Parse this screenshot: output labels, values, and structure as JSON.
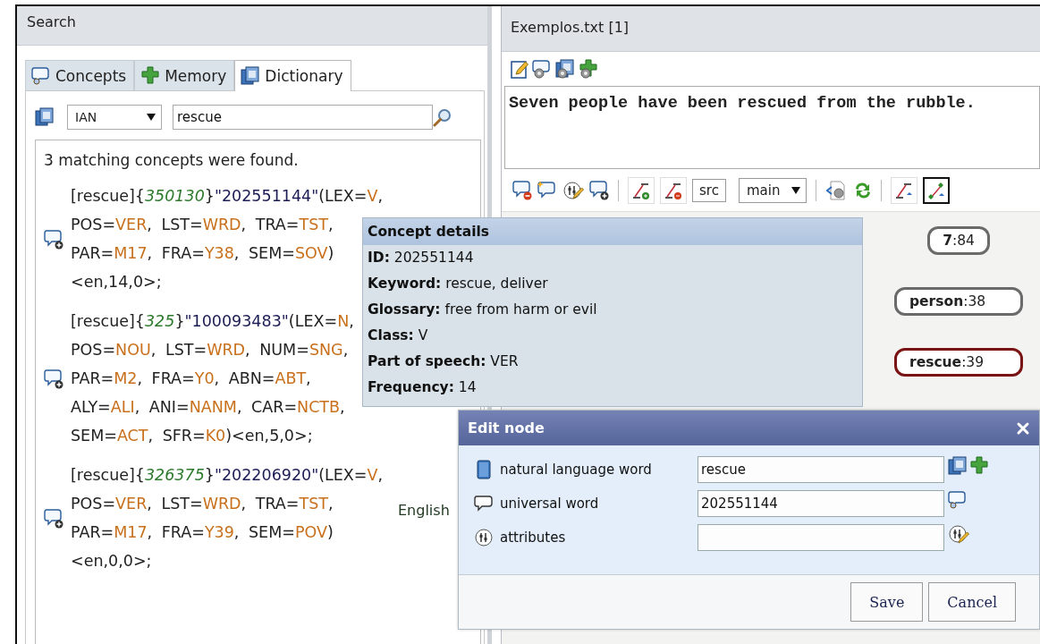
{
  "search_panel": {
    "title": "Search",
    "tabs": [
      {
        "label": "Concepts",
        "selected": false
      },
      {
        "label": "Memory",
        "selected": false
      },
      {
        "label": "Dictionary",
        "selected": true
      }
    ],
    "dictionary_select": {
      "value": "IAN"
    },
    "search_field": {
      "value": "rescue"
    },
    "result_summary": "3 matching concepts were found.",
    "results": [
      {
        "lines": [
          [
            {
              "text": "[rescue]{",
              "kind": "plain"
            },
            {
              "text": "350130",
              "kind": "number"
            },
            {
              "text": "}",
              "kind": "plain"
            },
            {
              "text": "\"202551144\"",
              "kind": "uw"
            },
            {
              "text": "(LEX=",
              "kind": "plain"
            },
            {
              "text": "V",
              "kind": "value"
            },
            {
              "text": ",",
              "kind": "plain"
            }
          ],
          [
            {
              "text": "POS=",
              "kind": "plain"
            },
            {
              "text": "VER",
              "kind": "value"
            },
            {
              "text": ", LST=",
              "kind": "plain"
            },
            {
              "text": "WRD",
              "kind": "value"
            },
            {
              "text": ", TRA=",
              "kind": "plain"
            },
            {
              "text": "TST",
              "kind": "value"
            },
            {
              "text": ",",
              "kind": "plain"
            }
          ],
          [
            {
              "text": "PAR=",
              "kind": "plain"
            },
            {
              "text": "M17",
              "kind": "value"
            },
            {
              "text": ", FRA=",
              "kind": "plain"
            },
            {
              "text": "Y38",
              "kind": "value"
            },
            {
              "text": ", SEM=",
              "kind": "plain"
            },
            {
              "text": "SOV",
              "kind": "value"
            },
            {
              "text": ")",
              "kind": "plain"
            }
          ],
          [
            {
              "text": "<en,14,0>;",
              "kind": "plain"
            }
          ]
        ]
      },
      {
        "lines": [
          [
            {
              "text": "[rescue]{",
              "kind": "plain"
            },
            {
              "text": "325",
              "kind": "number"
            },
            {
              "text": "}",
              "kind": "plain"
            },
            {
              "text": "\"100093483\"",
              "kind": "uw"
            },
            {
              "text": "(LEX=",
              "kind": "plain"
            },
            {
              "text": "N",
              "kind": "value"
            },
            {
              "text": ",",
              "kind": "plain"
            }
          ],
          [
            {
              "text": "POS=",
              "kind": "plain"
            },
            {
              "text": "NOU",
              "kind": "value"
            },
            {
              "text": ", LST=",
              "kind": "plain"
            },
            {
              "text": "WRD",
              "kind": "value"
            },
            {
              "text": ", NUM=",
              "kind": "plain"
            },
            {
              "text": "SNG",
              "kind": "value"
            },
            {
              "text": ",",
              "kind": "plain"
            }
          ],
          [
            {
              "text": "PAR=",
              "kind": "plain"
            },
            {
              "text": "M2",
              "kind": "value"
            },
            {
              "text": ", FRA=",
              "kind": "plain"
            },
            {
              "text": "Y0",
              "kind": "value"
            },
            {
              "text": ", ABN=",
              "kind": "plain"
            },
            {
              "text": "ABT",
              "kind": "value"
            },
            {
              "text": ",",
              "kind": "plain"
            }
          ],
          [
            {
              "text": "ALY=",
              "kind": "plain"
            },
            {
              "text": "ALI",
              "kind": "value"
            },
            {
              "text": ", ANI=",
              "kind": "plain"
            },
            {
              "text": "NANM",
              "kind": "value"
            },
            {
              "text": ", CAR=",
              "kind": "plain"
            },
            {
              "text": "NCTB",
              "kind": "value"
            },
            {
              "text": ",",
              "kind": "plain"
            }
          ],
          [
            {
              "text": "SEM=",
              "kind": "plain"
            },
            {
              "text": "ACT",
              "kind": "value"
            },
            {
              "text": ", SFR=",
              "kind": "plain"
            },
            {
              "text": "K0",
              "kind": "value"
            },
            {
              "text": ")<en,5,0>;",
              "kind": "plain"
            }
          ]
        ]
      },
      {
        "lines": [
          [
            {
              "text": "[rescue]{",
              "kind": "plain"
            },
            {
              "text": "326375",
              "kind": "number"
            },
            {
              "text": "}",
              "kind": "plain"
            },
            {
              "text": "\"202206920\"",
              "kind": "uw"
            },
            {
              "text": "(LEX=",
              "kind": "plain"
            },
            {
              "text": "V",
              "kind": "value"
            },
            {
              "text": ",",
              "kind": "plain"
            }
          ],
          [
            {
              "text": "POS=",
              "kind": "plain"
            },
            {
              "text": "VER",
              "kind": "value"
            },
            {
              "text": ", LST=",
              "kind": "plain"
            },
            {
              "text": "WRD",
              "kind": "value"
            },
            {
              "text": ", TRA=",
              "kind": "plain"
            },
            {
              "text": "TST",
              "kind": "value"
            },
            {
              "text": ",",
              "kind": "plain"
            }
          ],
          [
            {
              "text": "PAR=",
              "kind": "plain"
            },
            {
              "text": "M17",
              "kind": "value"
            },
            {
              "text": ", FRA=",
              "kind": "plain"
            },
            {
              "text": "Y39",
              "kind": "value"
            },
            {
              "text": ", SEM=",
              "kind": "plain"
            },
            {
              "text": "POV",
              "kind": "value"
            },
            {
              "text": ")",
              "kind": "plain"
            }
          ],
          [
            {
              "text": "<en,0,0>;",
              "kind": "plain"
            }
          ]
        ]
      }
    ]
  },
  "language_label": "English",
  "document_panel": {
    "title": "Exemplos.txt [1]",
    "text": "Seven people have been rescued from the rubble.",
    "src_button": "src",
    "layer_select": {
      "value": "main"
    },
    "view_buttons": [
      {
        "selected": false
      },
      {
        "selected": true
      }
    ]
  },
  "graph": {
    "nodes": [
      {
        "text": "**7**:84",
        "selected": false
      },
      {
        "text": "**person**:38",
        "selected": false
      },
      {
        "text": "**rescue**:39",
        "selected": true
      }
    ]
  },
  "concept_details": {
    "title": "Concept details",
    "rows": [
      "**ID:** 202551144",
      "**Keyword:** rescue, deliver",
      "**Glossary:** free from harm or evil",
      "**Class:** V",
      "**Part of speech:** VER",
      "**Frequency:** 14"
    ]
  },
  "edit_dialog": {
    "title": "Edit node",
    "fields": [
      {
        "label": "natural language word",
        "value": "rescue"
      },
      {
        "label": "universal word",
        "value": "202551144"
      },
      {
        "label": "attributes"
      }
    ],
    "buttons": [
      "Save",
      "Cancel"
    ]
  }
}
